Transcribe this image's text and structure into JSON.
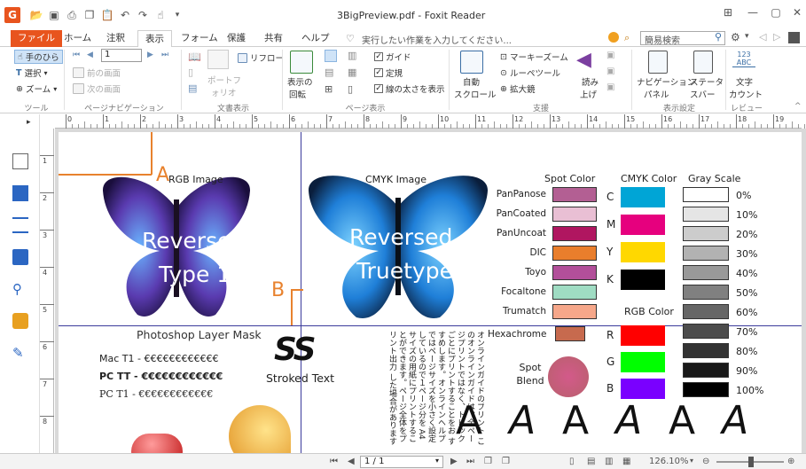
{
  "window": {
    "title": "3BigPreview.pdf - Foxit Reader"
  },
  "menu": {
    "tabs": [
      "ファイル",
      "ホーム",
      "注釈",
      "表示",
      "フォーム",
      "保護",
      "共有",
      "ヘルプ"
    ],
    "tell_me": "実行したい作業を入力してください...",
    "search_placeholder": "簡易検索"
  },
  "ribbon": {
    "tools": {
      "hand": "手のひら",
      "select": "選択",
      "zoom": "ズーム",
      "label": "ツール"
    },
    "pagenav": {
      "page_value": "1",
      "prev_page": "前の画面",
      "next_page": "次の画面",
      "label": "ページナビゲーション"
    },
    "docview": {
      "reflow": "リフロー",
      "portfolio": "ポートフ",
      "portfolio2": "ォリオ",
      "label": "文書表示"
    },
    "pageview": {
      "rotate": "表示の",
      "rotate2": "回転",
      "guide": "ガイド",
      "ruler": "定規",
      "linewidth": "線の太さを表示",
      "label": "ページ表示"
    },
    "assist": {
      "autoscroll": "自動",
      "autoscroll2": "スクロール",
      "marquee": "マーキーズーム",
      "loupe": "ルーペツール",
      "magnifier": "拡大鏡",
      "read": "読み",
      "read2": "上げ",
      "label": "支援"
    },
    "display": {
      "nav": "ナビゲーション",
      "nav2": "パネル",
      "status": "ステータ",
      "status2": "スバー",
      "label": "表示設定"
    },
    "review": {
      "count_icon": "123 ABC",
      "count": "文字",
      "count2": "カウント",
      "label": "レビュー"
    }
  },
  "ruler_h": [
    "0",
    "1",
    "2",
    "3",
    "4",
    "5",
    "6",
    "7",
    "8",
    "9",
    "10",
    "11",
    "12",
    "13",
    "14",
    "15",
    "16",
    "17",
    "18",
    "19",
    "20"
  ],
  "ruler_v": [
    "1",
    "2",
    "3",
    "4",
    "5",
    "6",
    "7",
    "8"
  ],
  "document": {
    "markers": {
      "a": "A",
      "b": "B"
    },
    "rgb_image": "RGB Image",
    "cmyk_image": "CMYK Image",
    "reversed1": "Reversed",
    "type1": "Type 1",
    "reversed2": "Reversed",
    "truetype": "Truetype",
    "layer_mask": "Photoshop Layer Mask",
    "fonts": [
      "Mac T1 - €€€€€€€€€€€€",
      "PC TT - €€€€€€€€€€€€",
      "PC T1 - €€€€€€€€€€€€"
    ],
    "stroked_glyphs": "SS",
    "stroked": "Stroked Text",
    "vertical_text": "オンラインガイドのプリント このオンラインガイドは、全ページプリントではなく、トピック ごとにプリントすることをお すすめします。オンラインヘルプ ではページサイズを小さく設定 しているので１ページ分を A4 サイズの用紙にプリントすることができます。ページ全体をプリント出力 した場合があります",
    "spot_title": "Spot Color",
    "spot": [
      {
        "name": "PanPanose",
        "color": "#b35f93"
      },
      {
        "name": "PanCoated",
        "color": "#e9bfd4"
      },
      {
        "name": "PanUncoat",
        "color": "#b01660"
      },
      {
        "name": "DIC",
        "color": "#e97e2c"
      },
      {
        "name": "Toyo",
        "color": "#b24f9a"
      },
      {
        "name": "Focaltone",
        "color": "#9fdcc3"
      },
      {
        "name": "Trumatch",
        "color": "#f6a78a"
      }
    ],
    "hexachrome": {
      "name": "Hexachrome",
      "color": "#c76a4e"
    },
    "spot_blend": "Spot Blend",
    "cmyk_title": "CMYK Color",
    "cmyk": [
      {
        "name": "C",
        "color": "#00a5d6"
      },
      {
        "name": "M",
        "color": "#e6007e"
      },
      {
        "name": "Y",
        "color": "#ffd800"
      },
      {
        "name": "K",
        "color": "#000000"
      }
    ],
    "rgb_title": "RGB Color",
    "rgb": [
      {
        "name": "R",
        "color": "#ff0000"
      },
      {
        "name": "G",
        "color": "#00ff00"
      },
      {
        "name": "B",
        "color": "#7a00ff"
      }
    ],
    "gray_title": "Gray Scale",
    "gray": [
      {
        "name": "0%",
        "color": "#ffffff"
      },
      {
        "name": "10%",
        "color": "#e5e5e5"
      },
      {
        "name": "20%",
        "color": "#cccccc"
      },
      {
        "name": "30%",
        "color": "#b2b2b2"
      },
      {
        "name": "40%",
        "color": "#999999"
      },
      {
        "name": "50%",
        "color": "#808080"
      },
      {
        "name": "60%",
        "color": "#666666"
      },
      {
        "name": "70%",
        "color": "#4c4c4c"
      },
      {
        "name": "80%",
        "color": "#333333"
      },
      {
        "name": "90%",
        "color": "#191919"
      },
      {
        "name": "100%",
        "color": "#000000"
      }
    ],
    "big_a": "A"
  },
  "status": {
    "page": "1 / 1",
    "zoom": "126.10%"
  },
  "colors": {
    "accent": "#e8541e",
    "guide": "#3b3b9b",
    "marker": "#e8822e"
  }
}
